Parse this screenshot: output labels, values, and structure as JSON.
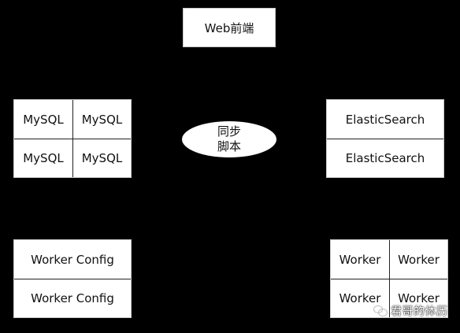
{
  "web_frontend": {
    "label": "Web前端"
  },
  "mysql": {
    "cells": [
      "MySQL",
      "MySQL",
      "MySQL",
      "MySQL"
    ]
  },
  "sync_script": {
    "line1": "同步",
    "line2": "脚本"
  },
  "elasticsearch": {
    "cells": [
      "ElasticSearch",
      "ElasticSearch"
    ]
  },
  "worker_config": {
    "cells": [
      "Worker Config",
      "Worker Config"
    ]
  },
  "worker": {
    "cells": [
      "Worker",
      "Worker",
      "Worker",
      "Worker"
    ]
  },
  "watermark": {
    "text": "君哥的体历",
    "icon": "wechat-icon"
  }
}
